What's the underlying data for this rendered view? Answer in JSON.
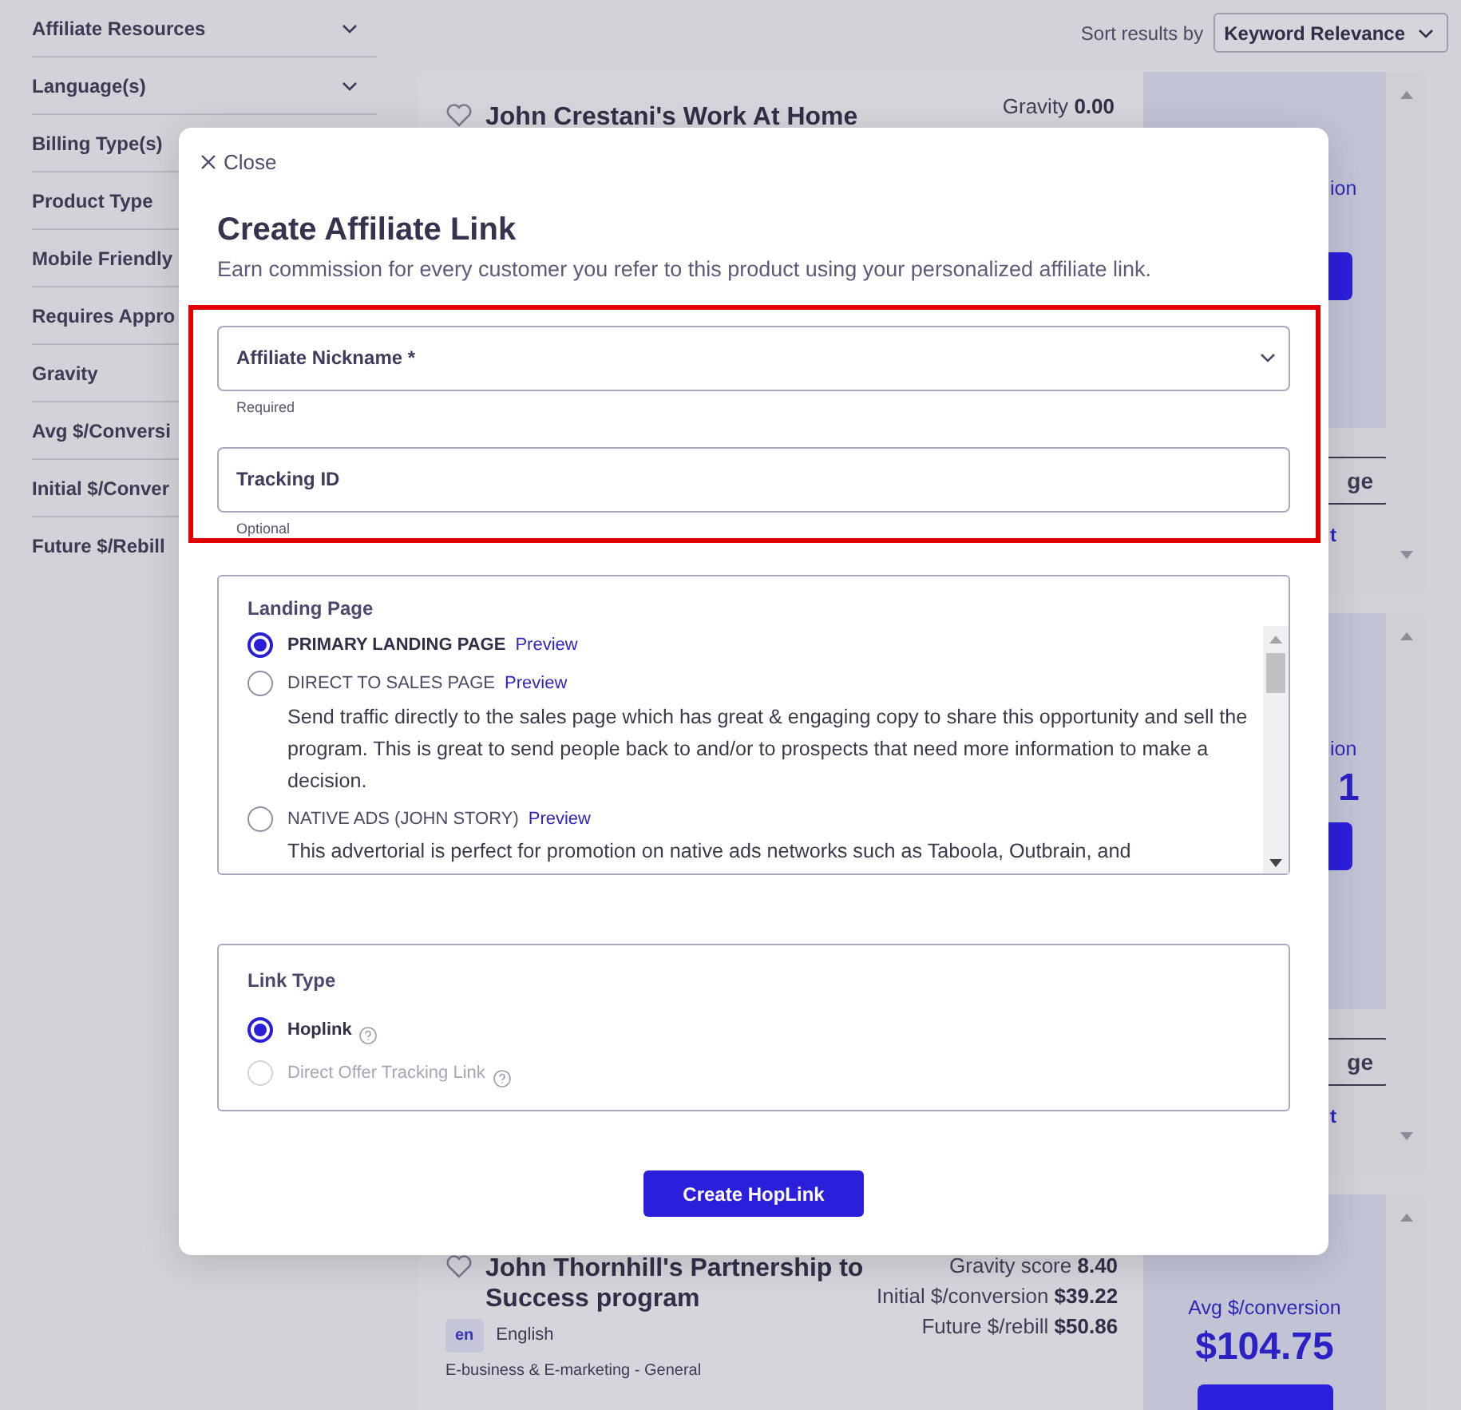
{
  "sidebar": {
    "filters": [
      {
        "label": "Affiliate Resources",
        "chevron": true
      },
      {
        "label": "Language(s)",
        "chevron": true
      },
      {
        "label": "Billing Type(s)",
        "chevron": false
      },
      {
        "label": "Product Type",
        "chevron": false
      },
      {
        "label": "Mobile Friendly",
        "chevron": false
      },
      {
        "label": "Requires Appro",
        "chevron": false
      },
      {
        "label": "Gravity",
        "chevron": false
      },
      {
        "label": "Avg $/Conversi",
        "chevron": false
      },
      {
        "label": "Initial $/Conver",
        "chevron": false
      },
      {
        "label": "Future $/Rebill",
        "chevron": false
      }
    ]
  },
  "sort": {
    "label": "Sort results by",
    "value": "Keyword Relevance"
  },
  "results": [
    {
      "title": "John Crestani's Work At Home",
      "stats": [
        {
          "label": "Gravity",
          "value": "0.00"
        }
      ],
      "panel": {
        "caption": "ion",
        "outline_button": "ge",
        "link": "t"
      }
    },
    {
      "panel": {
        "caption": "ion",
        "amount": "1",
        "outline_button": "ge",
        "link": "t"
      }
    },
    {
      "title": "John Thornhill's Partnership to Success program",
      "stats": [
        {
          "label": "Gravity score",
          "value": "8.40"
        },
        {
          "label": "Initial $/conversion",
          "value": "$39.22"
        },
        {
          "label": "Future $/rebill",
          "value": "$50.86"
        }
      ],
      "language": {
        "code": "en",
        "name": "English"
      },
      "category": "E-business & E-marketing - General",
      "panel": {
        "caption": "Avg $/conversion",
        "amount": "$104.75"
      }
    }
  ],
  "modal": {
    "close": "Close",
    "title": "Create Affiliate Link",
    "subtitle": "Earn commission for every customer you refer to this product using your personalized affiliate link.",
    "annotation": {
      "kind": "highlight-frame"
    },
    "fields": [
      {
        "kind": "select",
        "label": "Affiliate Nickname *",
        "hint": "Required"
      },
      {
        "kind": "text",
        "label": "Tracking ID",
        "hint": "Optional"
      }
    ],
    "landing_page": {
      "legend": "Landing Page",
      "options": [
        {
          "label": "PRIMARY LANDING PAGE",
          "link": "Preview",
          "selected": true
        },
        {
          "label": "DIRECT TO SALES PAGE",
          "link": "Preview",
          "selected": false,
          "description": "Send traffic directly to the sales page which has great & engaging copy to share this opportunity and sell the program. This is great to send people back to and/or to prospects that need more information to make a decision."
        },
        {
          "label": "NATIVE ADS (JOHN STORY)",
          "link": "Preview",
          "selected": false,
          "description": "This advertorial is perfect for promotion on native ads networks such as Taboola, Outbrain, and"
        }
      ]
    },
    "link_type": {
      "legend": "Link Type",
      "options": [
        {
          "label": "Hoplink",
          "selected": true,
          "disabled": false
        },
        {
          "label": "Direct Offer Tracking Link",
          "selected": false,
          "disabled": true
        }
      ]
    },
    "submit": "Create HopLink"
  }
}
